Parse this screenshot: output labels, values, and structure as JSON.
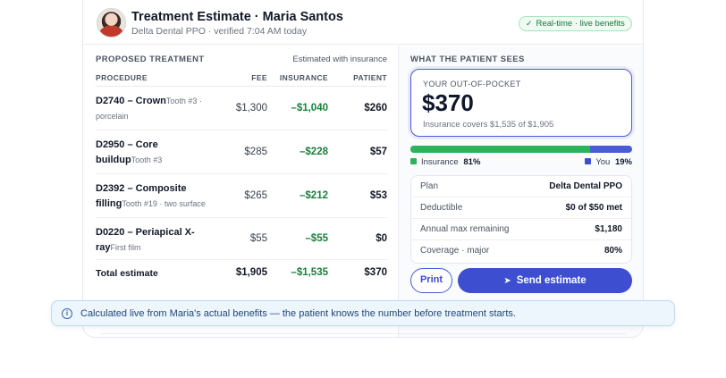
{
  "header": {
    "title": "Treatment Estimate · Maria Santos",
    "subtitle": "Delta Dental PPO · verified 7:04 AM today",
    "badge": "Real-time · live benefits"
  },
  "left": {
    "section_label": "Proposed treatment",
    "section_note": "Estimated with insurance",
    "columns": [
      "Procedure",
      "Fee",
      "Insurance",
      "Patient"
    ],
    "rows": [
      {
        "code": "D2740 – Crown",
        "detail": "Tooth #3 · porcelain",
        "fee": "$1,300",
        "insurance": "–$1,040",
        "patient": "$260"
      },
      {
        "code": "D2950 – Core buildup",
        "detail": "Tooth #3",
        "fee": "$285",
        "insurance": "–$228",
        "patient": "$57"
      },
      {
        "code": "D2392 – Composite filling",
        "detail": "Tooth #19 · two surface",
        "fee": "$265",
        "insurance": "–$212",
        "patient": "$53"
      },
      {
        "code": "D0220 – Periapical X-ray",
        "detail": "First film",
        "fee": "$55",
        "insurance": "–$55",
        "patient": "$0"
      }
    ],
    "total": {
      "label": "Total estimate",
      "fee": "$1,905",
      "insurance": "–$1,535",
      "patient": "$370"
    }
  },
  "right": {
    "section_label": "What the patient sees",
    "oop_label": "Your out-of-pocket",
    "oop_amount": "$370",
    "coverage_text": "Insurance covers $1,535 of $1,905",
    "split": {
      "insurance_pct": 81,
      "you_pct": 19
    },
    "legend": {
      "insurance_label": "Insurance",
      "insurance_value": "81%",
      "you_label": "You",
      "you_value": "19%"
    },
    "facts": [
      {
        "key": "Plan",
        "value": "Delta Dental PPO"
      },
      {
        "key": "Deductible",
        "value": "$0 of $50 met"
      },
      {
        "key": "Annual max remaining",
        "value": "$1,180"
      },
      {
        "key": "Coverage · major",
        "value": "80%"
      }
    ],
    "print_label": "Print",
    "send_label": "Send estimate"
  },
  "banner": {
    "text": "Calculated live from Maria's actual benefits — the patient knows the number before treatment starts."
  },
  "colors": {
    "accent": "#3d4fd0",
    "insurance_green": "#2cb45a",
    "credit_green": "#1a7f3c"
  },
  "icons": {
    "check": "check-icon",
    "send": "paper-plane-icon",
    "info": "info-icon"
  }
}
